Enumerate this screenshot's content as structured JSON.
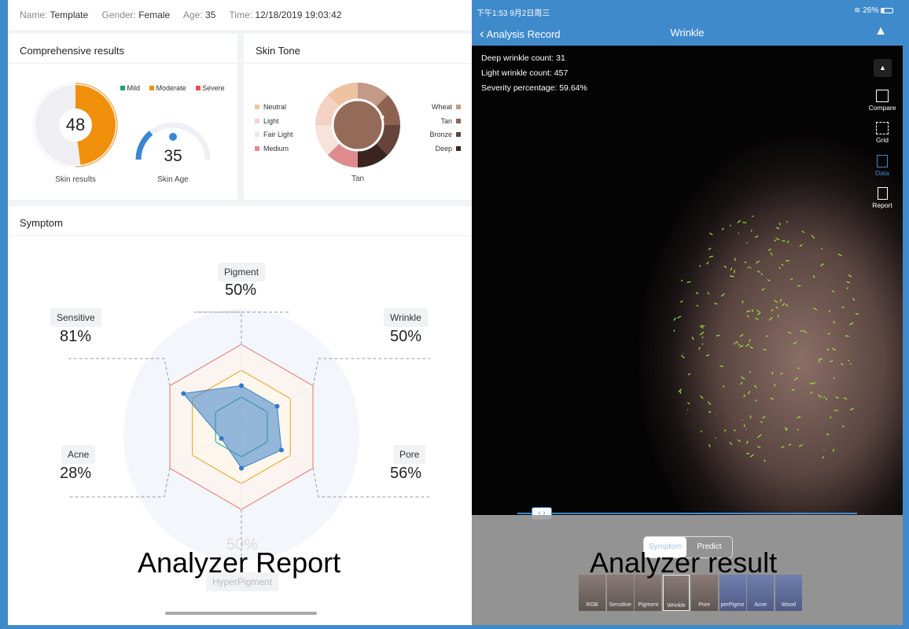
{
  "report": {
    "info": [
      {
        "k": "Name:",
        "v": "Template"
      },
      {
        "k": "Gender:",
        "v": "Female"
      },
      {
        "k": "Age:",
        "v": "35"
      },
      {
        "k": "Time:",
        "v": "12/18/2019 19:03:42"
      }
    ],
    "comprehensive": {
      "title": "Comprehensive results",
      "score": "48",
      "score_fraction": 0.48,
      "score_label": "Skin results",
      "age": "35",
      "age_label": "Skin Age",
      "legend": [
        {
          "label": "Mild",
          "color": "#1aa86b"
        },
        {
          "label": "Moderate",
          "color": "#f0900a"
        },
        {
          "label": "Severe",
          "color": "#e5524f"
        }
      ]
    },
    "skin_tone": {
      "title": "Skin Tone",
      "result": "Tan",
      "left": [
        {
          "label": "Neutral",
          "color": "#eec3a1"
        },
        {
          "label": "Light",
          "color": "#f3d2c4"
        },
        {
          "label": "Fair Light",
          "color": "#f8e3d8"
        },
        {
          "label": "Medium",
          "color": "#df8b8e"
        }
      ],
      "right": [
        {
          "label": "Wheat",
          "color": "#c29a86"
        },
        {
          "label": "Tan",
          "color": "#8d6350"
        },
        {
          "label": "Bronze",
          "color": "#674439"
        },
        {
          "label": "Deep",
          "color": "#3a241f"
        }
      ]
    },
    "symptom": {
      "title": "Symptom",
      "axes": [
        {
          "label": "Pigment",
          "value": "50%",
          "v": 50
        },
        {
          "label": "Wrinkle",
          "value": "50%",
          "v": 50
        },
        {
          "label": "Pore",
          "value": "56%",
          "v": 56
        },
        {
          "label": "HyperPigment",
          "value": "50%",
          "v": 50
        },
        {
          "label": "Acne",
          "value": "28%",
          "v": 28
        },
        {
          "label": "Sensitive",
          "value": "81%",
          "v": 81
        }
      ]
    },
    "caption": "Analyzer Report"
  },
  "result": {
    "status_time": "下午1:53   9月2日周三",
    "battery": "26%",
    "battery_level": 0.26,
    "back_label": "Analysis Record",
    "title": "Wrinkle",
    "stats": [
      "Deep wrinkle count:  31",
      "Light wrinkle count:  457",
      "Severity percentage:  59.64%"
    ],
    "tools": [
      {
        "label": "Compare",
        "icon": "compare-icon"
      },
      {
        "label": "Grid",
        "icon": "grid-icon"
      },
      {
        "label": "Data",
        "icon": "data-icon",
        "active": true
      },
      {
        "label": "Report",
        "icon": "report-icon"
      }
    ],
    "tabs": [
      "Symptom",
      "Predict"
    ],
    "thumbs": [
      "RGB",
      "Sensitive",
      "Pigment",
      "Wrinkle",
      "Pore",
      "perPigme",
      "Acne",
      "Wood"
    ],
    "selected_thumb": "Wrinkle",
    "caption": "Analyzer result",
    "accent": "#3f8acb"
  }
}
